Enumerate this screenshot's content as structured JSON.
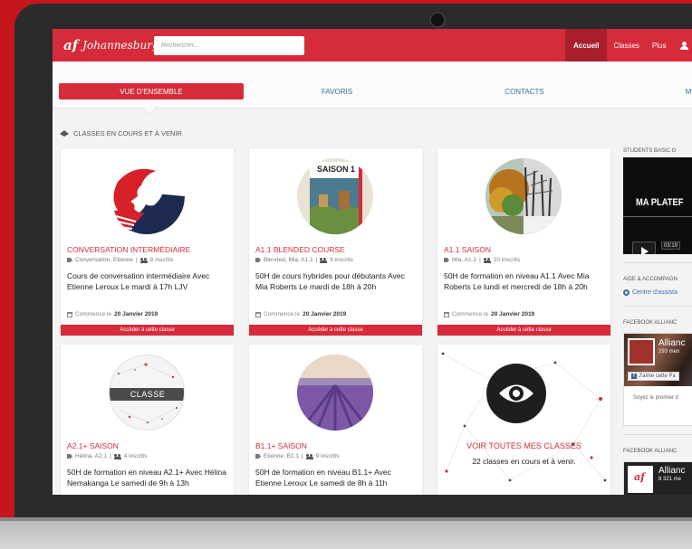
{
  "colors": {
    "brand": "#d62b3a",
    "link": "#3a6ea5",
    "page_bg": "#c4161c"
  },
  "navbar": {
    "logo_text": "Johannesburg",
    "logo_mark": "af",
    "search_placeholder": "Rechercher...",
    "links": [
      "Accueil",
      "Classes",
      "Plus"
    ],
    "active_link": "Accueil"
  },
  "tabs": [
    {
      "label": "VUE D'ENSEMBLE",
      "active": true
    },
    {
      "label": "FAVORIS",
      "active": false
    },
    {
      "label": "CONTACTS",
      "active": false
    },
    {
      "label": "M",
      "active": false
    }
  ],
  "section_title": "CLASSES EN COURS ET À VENIR",
  "cards": [
    {
      "title": "CONVERSATION INTERMÉDIAIRE",
      "meta": "Conversation, Etienne",
      "students": "8 inscrits",
      "description": "Cours de conversation intermédiaire Avec Etienne Leroux Le mardi à 17h LJV",
      "start_label": "Commence le",
      "start_date": "20 Janvier 2019",
      "button": "Accéder à cette classe"
    },
    {
      "title": "A1.1 BLENDED COURSE",
      "meta": "Blended, Mia, A1.1",
      "students": "9 inscrits",
      "description": "50H de cours hybrides pour débutants Avec Mia Roberts Le mardi de 18h à 20h",
      "start_label": "Commence le",
      "start_date": "20 Janvier 2019",
      "button": "Accéder à cette classe",
      "image_text": "SAISON 1"
    },
    {
      "title": "A1.1 SAISON",
      "meta": "Mia, A1.1",
      "students": "10 inscrits",
      "description": "50H de formation en niveau A1.1 Avec Mia Roberts Le lundi et mercredi de 18h à 20h",
      "start_label": "Commence le",
      "start_date": "20 Janvier 2019",
      "button": "Accéder à cette classe"
    },
    {
      "title": "A2.1+ SAISON",
      "meta": "Hélina, A2.1",
      "students": "4 inscrits",
      "description": "50H de formation en niveau A2.1+ Avec Hélina Nemakanga Le samedi de 9h à 13h",
      "image_text": "CLASSE"
    },
    {
      "title": "B1.1+ SAISON",
      "meta": "Etienne, B1.1",
      "students": "9 inscrits",
      "description": "50H de formation en niveau B1.1+ Avec Etienne Leroux Le samedi de 8h à 11h"
    }
  ],
  "view_all": {
    "title": "VOIR TOUTES MES CLASSES",
    "subtitle": "22 classes en cours et à venir."
  },
  "sidebar": {
    "video_heading": "STUDENTS BASIC G",
    "video_title": "MA PLATEF",
    "video_time": "03:19",
    "help_heading": "AIDE & ACCOMPAGN",
    "help_link": "Centre d'assista",
    "fb_heading_1": "FACEBOOK ALLIANC",
    "fb_name_1": "Allianc",
    "fb_sub_1": "293 men",
    "fb_like": "J'aime cette Pa",
    "fb_first": "Soyez le premier d",
    "fb_heading_2": "FACEBOOK ALLIANC",
    "fb_name_2": "Allianc",
    "fb_sub_2": "8 321 me"
  }
}
